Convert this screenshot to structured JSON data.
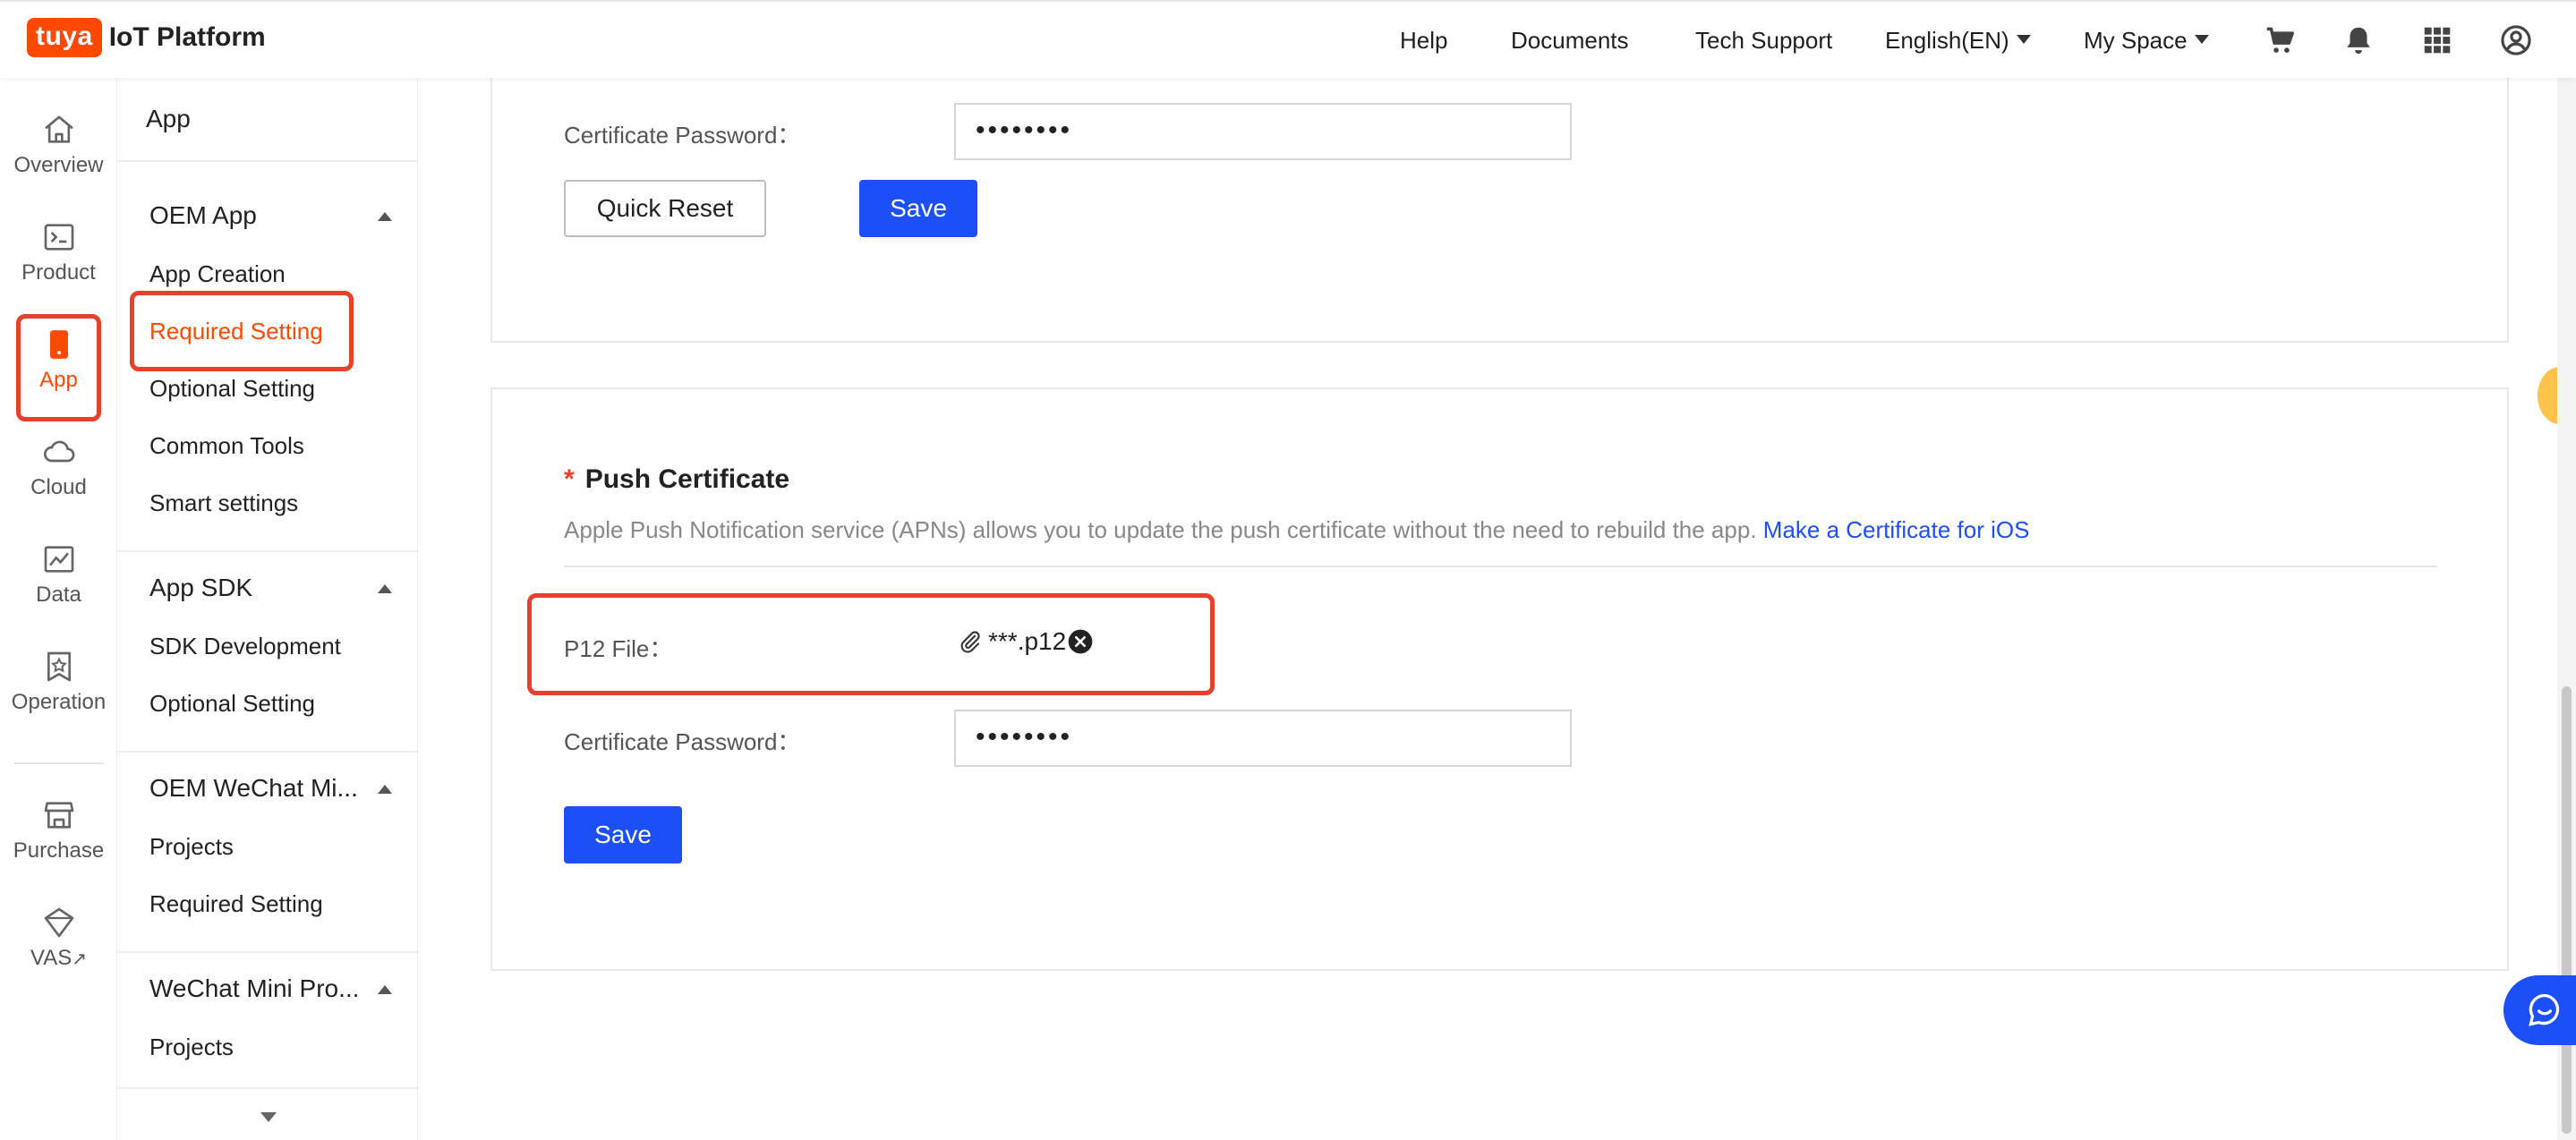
{
  "header": {
    "logo_badge": "tuya",
    "logo_text": "IoT Platform",
    "nav": {
      "help": "Help",
      "documents": "Documents",
      "tech_support": "Tech Support",
      "language": "English(EN)",
      "space": "My Space"
    }
  },
  "rail": {
    "items": [
      {
        "label": "Overview",
        "icon": "home-icon"
      },
      {
        "label": "Product",
        "icon": "terminal-icon"
      },
      {
        "label": "App",
        "icon": "phone-icon"
      },
      {
        "label": "Cloud",
        "icon": "cloud-icon"
      },
      {
        "label": "Data",
        "icon": "chart-icon"
      },
      {
        "label": "Operation",
        "icon": "badge-icon"
      },
      {
        "label": "Purchase",
        "icon": "store-icon"
      },
      {
        "label": "VAS",
        "icon": "diamond-icon"
      }
    ]
  },
  "submenu": {
    "title": "App",
    "groups": [
      {
        "title": "OEM App",
        "items": [
          "App Creation",
          "Required Setting",
          "Optional Setting",
          "Common Tools",
          "Smart settings"
        ]
      },
      {
        "title": "App SDK",
        "items": [
          "SDK Development",
          "Optional Setting"
        ]
      },
      {
        "title": "OEM WeChat Mi...",
        "items": [
          "Projects",
          "Required Setting"
        ]
      },
      {
        "title": "WeChat Mini Pro...",
        "items": [
          "Projects"
        ]
      }
    ]
  },
  "top_card": {
    "password_label": "Certificate Password：",
    "password_value": "••••••••",
    "quick_reset_label": "Quick Reset",
    "save_label": "Save"
  },
  "push_card": {
    "required_mark": "*",
    "title": "Push Certificate",
    "description": "Apple Push Notification service (APNs) allows you to update the push certificate without the need to rebuild the app.",
    "link_text": "Make a Certificate for iOS",
    "p12_label": "P12 File：",
    "file_name": "***.p12",
    "password_label": "Certificate Password：",
    "password_value": "••••••••",
    "save_label": "Save"
  },
  "colors": {
    "accent": "#ff4800",
    "primary": "#1c4ff5",
    "highlight": "#e8402c"
  }
}
